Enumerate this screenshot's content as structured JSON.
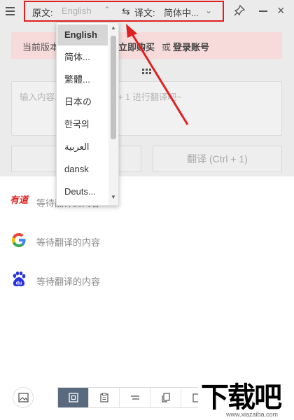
{
  "titlebar": {
    "source_label": "原文:",
    "source_lang": "English",
    "target_label": "译文:",
    "target_lang": "简体中...",
    "swap_icon": "swap-arrows-icon"
  },
  "notice": {
    "prefix": "当前版本",
    "buy_link": "立即购买",
    "or": "或",
    "login_link": "登录账号"
  },
  "input": {
    "placeholder": "输入内容...  用快捷键 Ctrl + 1 进行翻译吧~"
  },
  "buttons": {
    "translate": "翻译 (Ctrl + 1)"
  },
  "dropdown": {
    "selected": "English",
    "items": [
      "English",
      "简体...",
      "繁體...",
      "日本の",
      "한국의",
      "العربية",
      "dansk",
      "Deuts..."
    ]
  },
  "results": [
    {
      "engine": "youdao",
      "engine_label": "有道",
      "text": "等待翻译的内容"
    },
    {
      "engine": "google",
      "text": "等待翻译的内容"
    },
    {
      "engine": "baidu",
      "text": "等待翻译的内容"
    }
  ],
  "watermark": {
    "big": "下载吧",
    "small": "www.xiazaiba.com"
  },
  "colors": {
    "highlight_border": "#e02020",
    "notice_bg": "#f7dada",
    "active_tool": "#5a6a7e"
  }
}
